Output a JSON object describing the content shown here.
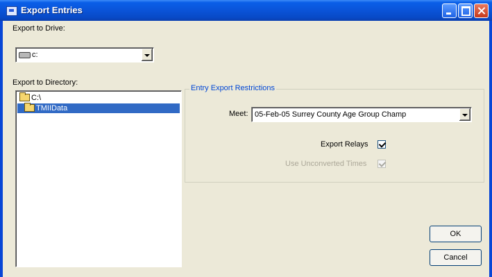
{
  "window": {
    "title": "Export Entries",
    "icon": "app-icon"
  },
  "drive": {
    "label": "Export to Drive:",
    "value": "c:",
    "icon": "drive-icon"
  },
  "directory": {
    "label": "Export to Directory:",
    "items": [
      {
        "name": "C:\\",
        "icon": "open-folder-icon",
        "selected": false
      },
      {
        "name": "TMIIData",
        "icon": "open-folder-icon",
        "selected": true
      }
    ]
  },
  "restrictions": {
    "title": "Entry Export Restrictions",
    "meet_label": "Meet:",
    "meet_value": "05-Feb-05 Surrey County Age Group Champ",
    "export_relays_label": "Export Relays",
    "export_relays_checked": true,
    "unconverted_label": "Use Unconverted Times",
    "unconverted_checked": true,
    "unconverted_enabled": false
  },
  "buttons": {
    "ok": "OK",
    "cancel": "Cancel"
  },
  "colors": {
    "titlebar": "#0a54d8",
    "dialog_bg": "#ece9d8",
    "selection": "#316ac5",
    "group_title": "#0046d5"
  }
}
